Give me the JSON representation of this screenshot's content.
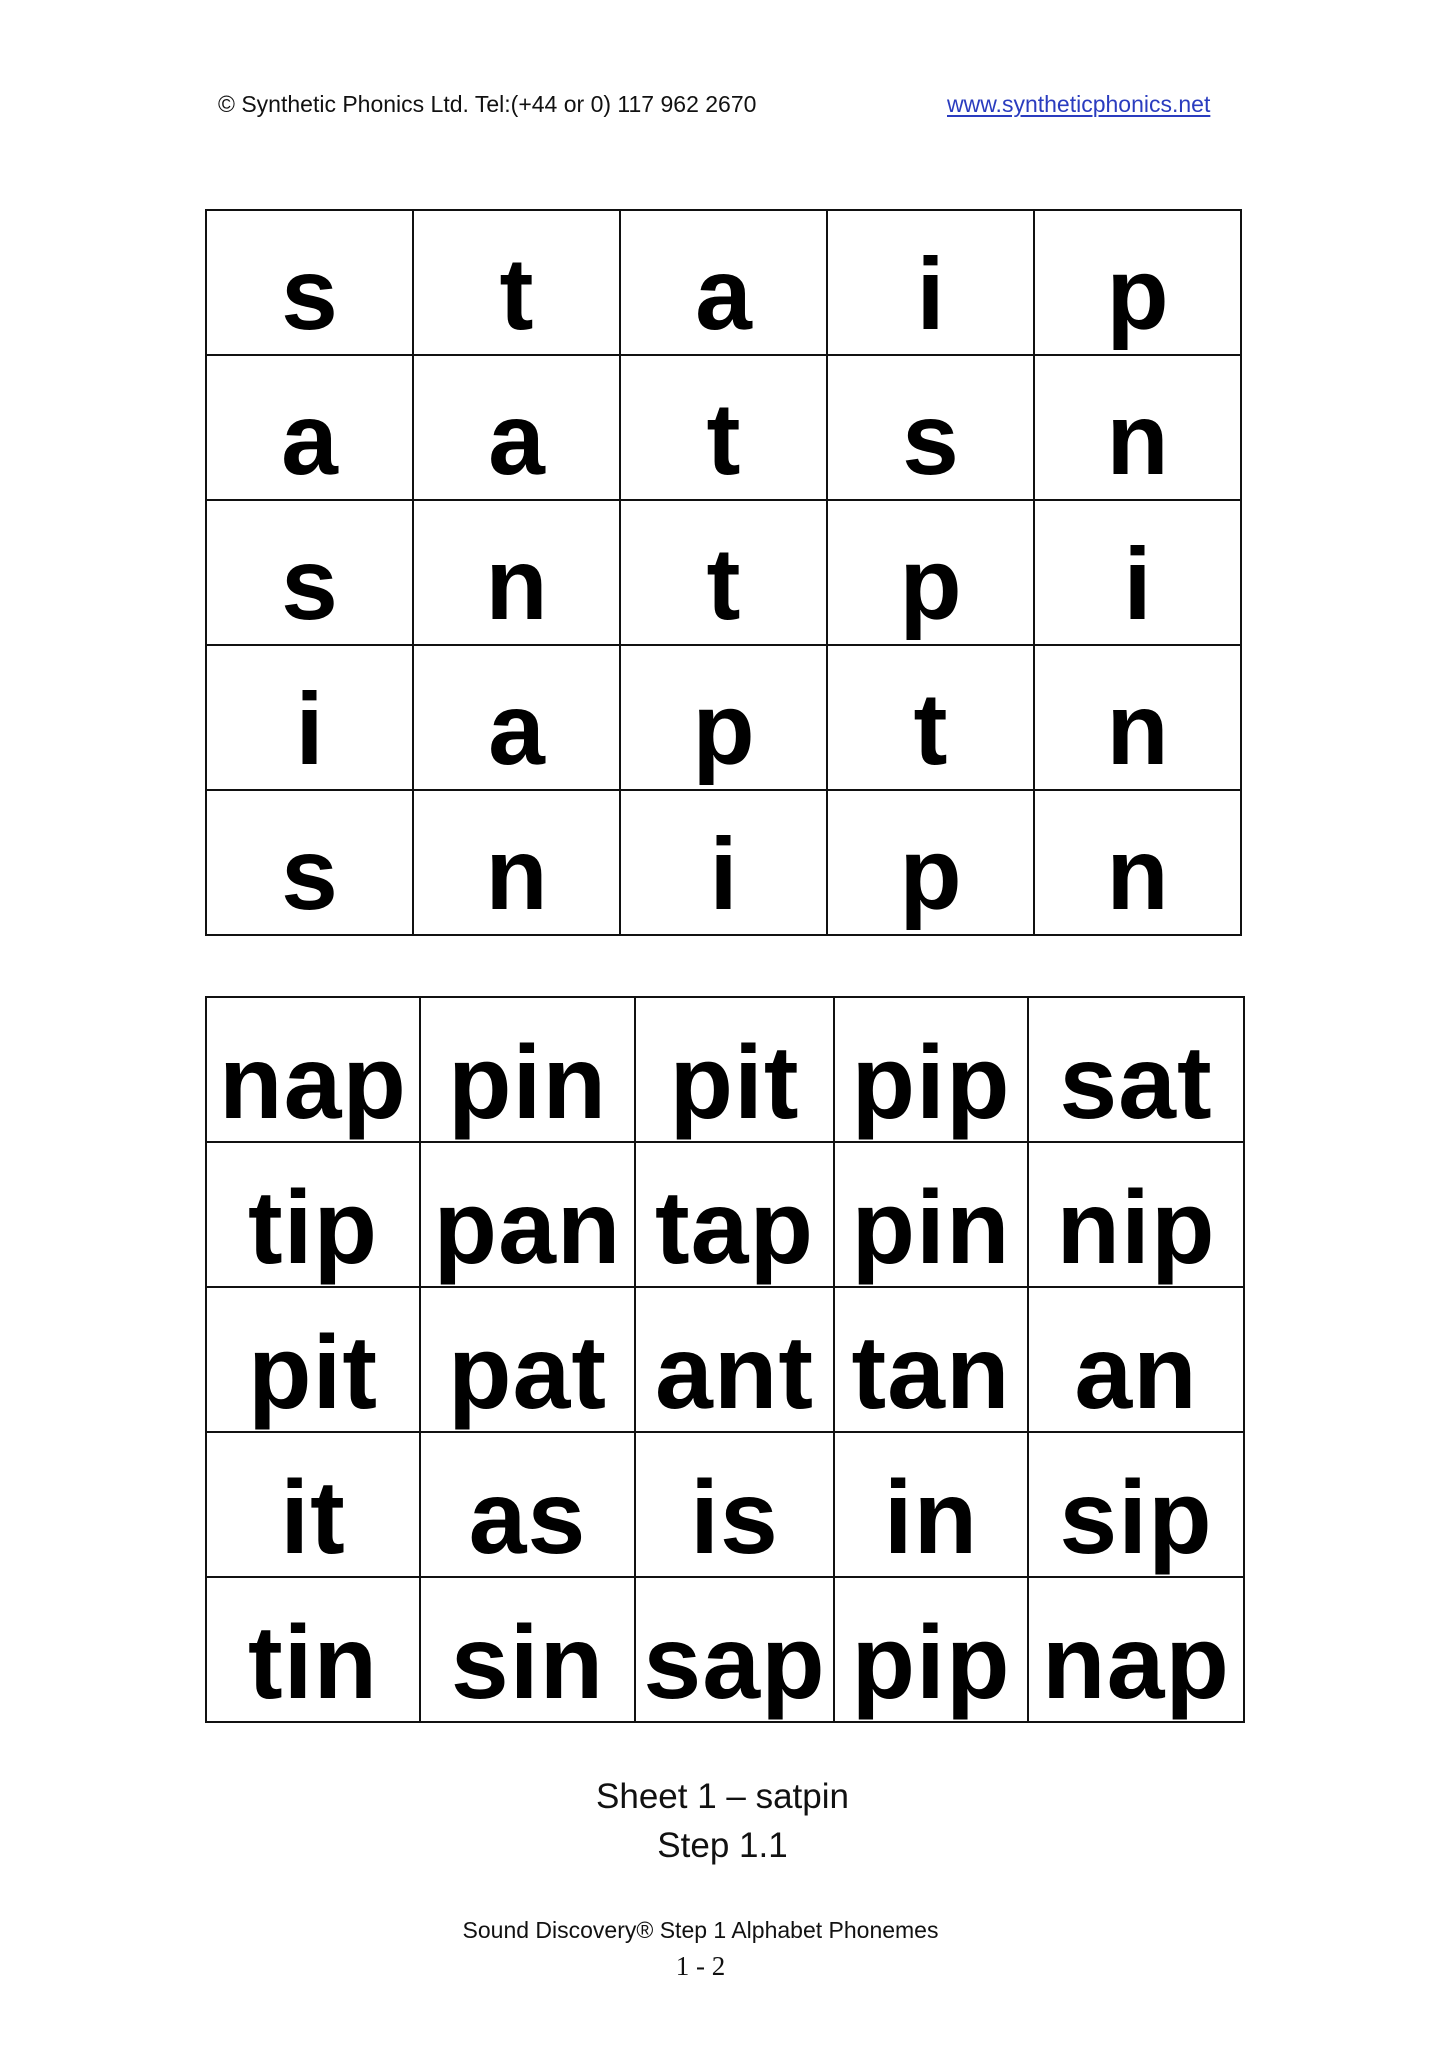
{
  "header": {
    "copyright": "© Synthetic Phonics Ltd. Tel:(+44 or 0) 117 962 2670",
    "website": "www.syntheticphonics.net"
  },
  "letter_grid": [
    [
      "s",
      "t",
      "a",
      "i",
      "p"
    ],
    [
      "a",
      "a",
      "t",
      "s",
      "n"
    ],
    [
      "s",
      "n",
      "t",
      "p",
      "i"
    ],
    [
      "i",
      "a",
      "p",
      "t",
      "n"
    ],
    [
      "s",
      "n",
      "i",
      "p",
      "n"
    ]
  ],
  "word_grid": [
    [
      "nap",
      "pin",
      "pit",
      "pip",
      "sat"
    ],
    [
      "tip",
      "pan",
      "tap",
      "pin",
      "nip"
    ],
    [
      "pit",
      "pat",
      "ant",
      "tan",
      "an"
    ],
    [
      "it",
      "as",
      "is",
      "in",
      "sip"
    ],
    [
      "tin",
      "sin",
      "sap",
      "pip",
      "nap"
    ]
  ],
  "sheet": {
    "title": "Sheet 1 – satpin",
    "step": "Step 1.1"
  },
  "footer": {
    "title": "Sound Discovery® Step 1 Alphabet Phonemes",
    "page": "1 - 2"
  },
  "colors": {
    "link": "#2a3cbf",
    "text": "#000000",
    "grid_border": "#111111"
  }
}
